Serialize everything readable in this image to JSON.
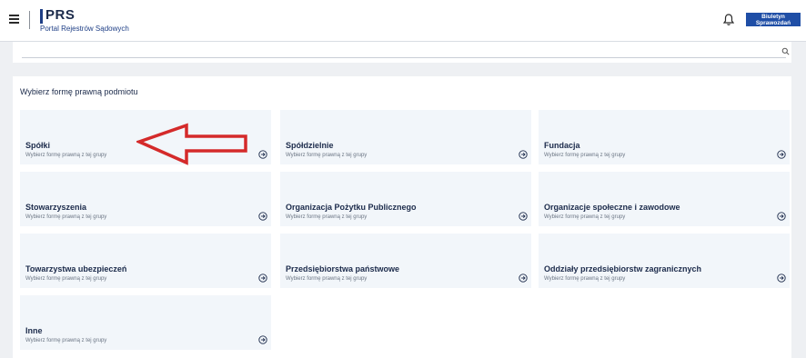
{
  "header": {
    "logo_title": "PRS",
    "logo_subtitle": "Portal Rejestrów Sądowych",
    "button_label": "Biuletyn Sprawozdań"
  },
  "search": {
    "placeholder": ""
  },
  "section": {
    "title": "Wybierz formę prawną podmiotu"
  },
  "tiles": [
    {
      "label": "Spółki",
      "sub": "Wybierz formę prawną z tej grupy"
    },
    {
      "label": "Spółdzielnie",
      "sub": "Wybierz formę prawną z tej grupy"
    },
    {
      "label": "Fundacja",
      "sub": "Wybierz formę prawną z tej grupy"
    },
    {
      "label": "Stowarzyszenia",
      "sub": "Wybierz formę prawną z tej grupy"
    },
    {
      "label": "Organizacja Pożytku Publicznego",
      "sub": "Wybierz formę prawną z tej grupy"
    },
    {
      "label": "Organizacje społeczne i zawodowe",
      "sub": "Wybierz formę prawną z tej grupy"
    },
    {
      "label": "Towarzystwa ubezpieczeń",
      "sub": "Wybierz formę prawną z tej grupy"
    },
    {
      "label": "Przedsiębiorstwa państwowe",
      "sub": "Wybierz formę prawną z tej grupy"
    },
    {
      "label": "Oddziały przedsiębiorstw zagranicznych",
      "sub": "Wybierz formę prawną z tej grupy"
    },
    {
      "label": "Inne",
      "sub": "Wybierz formę prawną z tej grupy"
    }
  ],
  "colors": {
    "brand": "#1f4ea6",
    "tile_bg": "#f2f6fa",
    "annotation": "#d42a2a"
  },
  "icons": {
    "menu": "hamburger-menu-icon",
    "bell": "bell-icon",
    "search": "search-icon",
    "tile_arrow": "arrow-circle-right-icon"
  }
}
